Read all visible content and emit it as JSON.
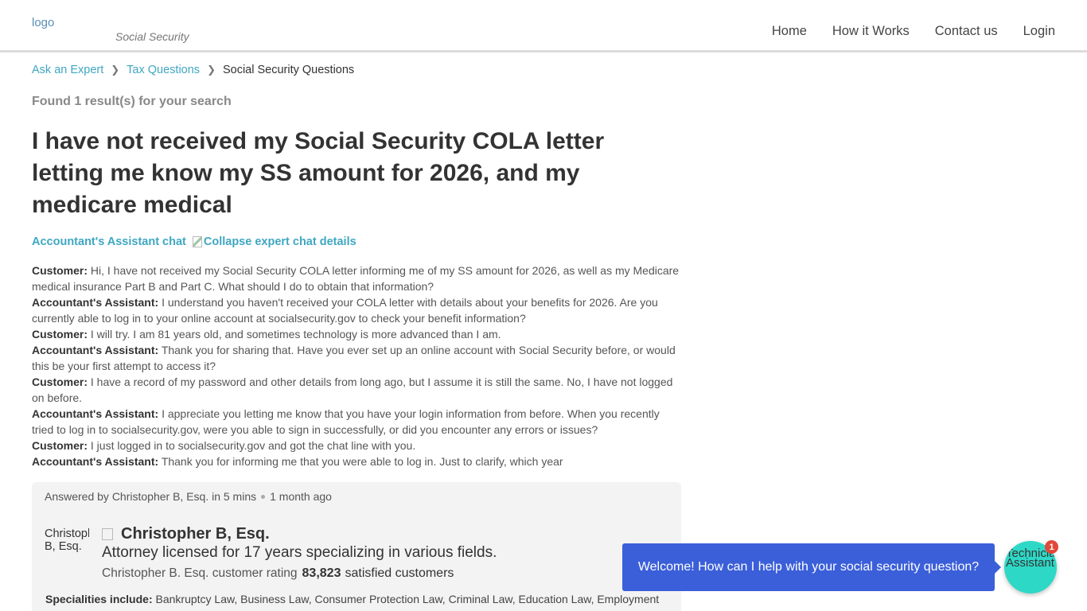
{
  "header": {
    "logo_alt": "logo",
    "tagline": "Social Security",
    "nav": [
      "Home",
      "How it Works",
      "Contact us",
      "Login"
    ]
  },
  "breadcrumb": {
    "items": [
      "Ask an Expert",
      "Tax Questions"
    ],
    "current": "Social Security Questions"
  },
  "results_text": "Found 1 result(s) for your search",
  "question_title": "I have not received my Social Security COLA letter letting me know my SS amount for 2026, and my medicare medical",
  "chat_header": {
    "title": "Accountant's Assistant chat",
    "collapse_alt": "Collapse expert chat details"
  },
  "transcript": [
    {
      "speaker": "Customer:",
      "text": "Hi, I have not received my Social Security COLA letter informing me of my SS amount for 2026, as well as my Medicare medical insurance Part B and Part C. What should I do to obtain that information?"
    },
    {
      "speaker": "Accountant's Assistant:",
      "text": "I understand you haven't received your COLA letter with details about your benefits for 2026. Are you currently able to log in to your online account at socialsecurity.gov to check your benefit information?"
    },
    {
      "speaker": "Customer:",
      "text": "I will try. I am 81 years old, and sometimes technology is more advanced than I am."
    },
    {
      "speaker": "Accountant's Assistant:",
      "text": "Thank you for sharing that. Have you ever set up an online account with Social Security before, or would this be your first attempt to access it?"
    },
    {
      "speaker": "Customer:",
      "text": "I have a record of my password and other details from long ago, but I assume it is still the same. No, I have not logged on before."
    },
    {
      "speaker": "Accountant's Assistant:",
      "text": "I appreciate you letting me know that you have your login information from before. When you recently tried to log in to socialsecurity.gov, were you able to sign in successfully, or did you encounter any errors or issues?"
    },
    {
      "speaker": "Customer:",
      "text": "I just logged in to socialsecurity.gov and got the chat line with you."
    },
    {
      "speaker": "Accountant's Assistant:",
      "text": "Thank you for informing me that you were able to log in. Just to clarify, which year"
    }
  ],
  "answer": {
    "answered_by": "Answered by Christopher B, Esq. in 5 mins",
    "time_ago": "1 month ago",
    "avatar_alt": "Christopher B, Esq.",
    "expert_name": "Christopher B, Esq.",
    "description": "Attorney licensed for 17 years specializing in various fields.",
    "rating_alt": "Christopher B. Esq. customer rating",
    "satisfied_count": "83,823",
    "satisfied_label": "satisfied customers",
    "specialities_label": "Specialities include:",
    "specialities": "Bankruptcy Law, Business Law, Consumer Protection Law, Criminal Law, Education Law, Employment"
  },
  "chat_widget": {
    "message": "Welcome! How can I help with your social security question?",
    "avatar_text": "Technician Assistant",
    "badge": "1"
  },
  "colors": {
    "link": "#3fa7c2",
    "chat_bubble": "#3b5fd9",
    "chat_avatar": "#2ed8c6",
    "badge": "#e2493a"
  }
}
